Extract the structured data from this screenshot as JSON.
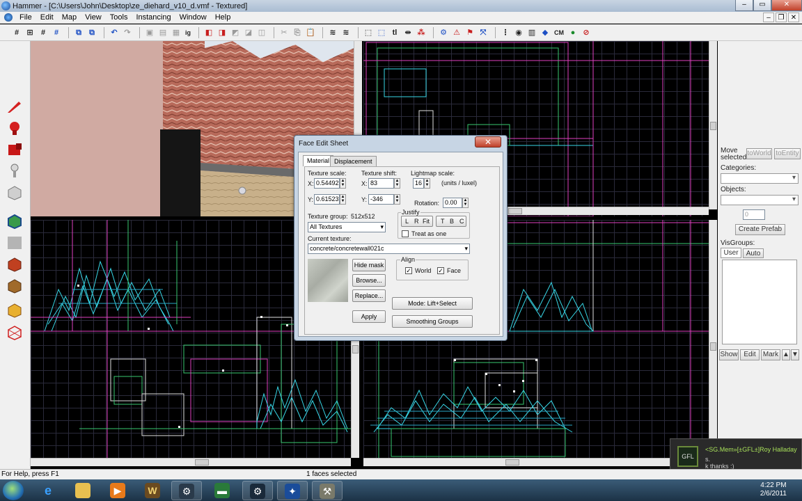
{
  "window": {
    "title": "Hammer - [C:\\Users\\John\\Desktop\\ze_diehard_v10_d.vmf - Textured]"
  },
  "menu": [
    "File",
    "Edit",
    "Map",
    "View",
    "Tools",
    "Instancing",
    "Window",
    "Help"
  ],
  "toolbar": {
    "cm_label": "CM"
  },
  "right_panel": {
    "move_selected": "Move selected:",
    "to_world": "toWorld",
    "to_entity": "toEntity",
    "categories": "Categories:",
    "objects": "Objects:",
    "spin_value": "0",
    "create_prefab": "Create Prefab",
    "visgroups": "VisGroups:",
    "tab_user": "User",
    "tab_auto": "Auto",
    "show": "Show",
    "edit": "Edit",
    "mark": "Mark"
  },
  "dialog": {
    "title": "Face Edit Sheet",
    "tabs": [
      "Material",
      "Displacement"
    ],
    "texture_scale": "Texture scale:",
    "texture_shift": "Texture shift:",
    "lightmap_scale": "Lightmap scale:",
    "units_luxel": "(units / luxel)",
    "x_label": "X:",
    "y_label": "Y:",
    "scale_x": "0.54492",
    "scale_y": "0.61523",
    "shift_x": "83",
    "shift_y": "-346",
    "lightmap": "16",
    "rotation_label": "Rotation:",
    "rotation": "0.00",
    "justify": "Justify",
    "j_l": "L",
    "j_r": "R",
    "j_fit": "Fit",
    "j_t": "T",
    "j_b": "B",
    "j_c": "C",
    "treat_as_one": "Treat as one",
    "texture_group": "Texture group:",
    "texture_size": "512x512",
    "group_value": "All Textures",
    "current_texture": "Current texture:",
    "texture_value": "concrete/concretewall021c",
    "hide_mask": "Hide mask",
    "browse": "Browse...",
    "replace": "Replace...",
    "apply": "Apply",
    "align": "Align",
    "world": "World",
    "face": "Face",
    "mode": "Mode: Lift+Select",
    "smoothing": "Smoothing Groups"
  },
  "status": {
    "help": "For Help, press F1",
    "selection": "1 faces selected"
  },
  "notification": {
    "name": "<SG.Mem»[±GFL±]Roy Halladay",
    "line1": "s.",
    "line2": "k thanks :)",
    "avatar": "GFL"
  },
  "clock": {
    "time": "4:22 PM",
    "date": "2/6/2011"
  },
  "colors": {
    "wire_cyan": "#38d8e8",
    "wire_pink": "#e040c0",
    "wire_green": "#38c870",
    "titlebar": "#b7c8dc"
  }
}
